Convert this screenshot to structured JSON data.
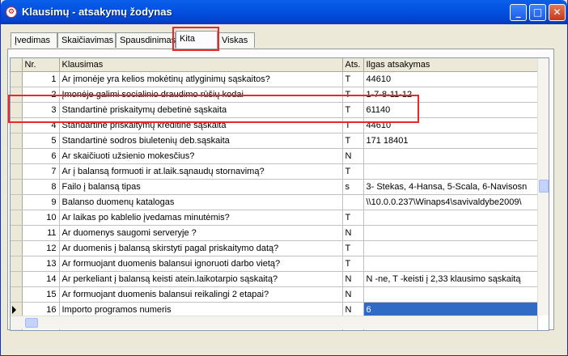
{
  "window": {
    "title": "Klausimų - atsakymų žodynas"
  },
  "tabs": [
    {
      "label": "Įvedimas"
    },
    {
      "label": "Skaičiavimas"
    },
    {
      "label": "Spausdinimas"
    },
    {
      "label": "Kita"
    },
    {
      "label": "Viskas"
    }
  ],
  "active_tab": "Kita",
  "table": {
    "headers": [
      "Nr.",
      "Klausimas",
      "Ats.",
      "Ilgas atsakymas"
    ],
    "rows": [
      {
        "nr": "1",
        "q": "Ar įmonėje yra kelios mokėtinų atlyginimų sąskaitos?",
        "a": "T",
        "long": "44610"
      },
      {
        "nr": "2",
        "q": "Įmonėje galimi socialinio draudimo rūšių kodai",
        "a": "T",
        "long": "1-7-8-11-12"
      },
      {
        "nr": "3",
        "q": "Standartinė priskaitymų debetinė sąskaita",
        "a": "T",
        "long": "61140"
      },
      {
        "nr": "4",
        "q": "Standartinė priskaitymų kreditinė sąskaita",
        "a": "T",
        "long": "44610"
      },
      {
        "nr": "5",
        "q": "Standartinė sodros biuletenių deb.sąskaita",
        "a": "T",
        "long": "171 18401"
      },
      {
        "nr": "6",
        "q": "Ar skaičiuoti užsienio mokesčius?",
        "a": "N",
        "long": ""
      },
      {
        "nr": "7",
        "q": "Ar į balansą formuoti ir at.laik.sąnaudų stornavimą?",
        "a": "T",
        "long": ""
      },
      {
        "nr": "8",
        "q": "Failo į balansą tipas",
        "a": "s",
        "long": "3- Stekas, 4-Hansa, 5-Scala, 6-Navisosn"
      },
      {
        "nr": "9",
        "q": "Balanso duomenų katalogas",
        "a": "",
        "long": "\\\\10.0.0.237\\Winaps4\\savivaldybe2009\\"
      },
      {
        "nr": "10",
        "q": "Ar laikas po kablelio įvedamas minutėmis?",
        "a": "T",
        "long": ""
      },
      {
        "nr": "11",
        "q": "Ar duomenys saugomi serveryje ?",
        "a": "N",
        "long": ""
      },
      {
        "nr": "12",
        "q": "Ar duomenis į balansą skirstyti pagal priskaitymo datą?",
        "a": "T",
        "long": ""
      },
      {
        "nr": "13",
        "q": "Ar formuojant duomenis balansui ignoruoti darbo vietą?",
        "a": "T",
        "long": ""
      },
      {
        "nr": "14",
        "q": "Ar perkeliant į balansą keisti atein.laikotarpio sąskaitą?",
        "a": "N",
        "long": "N -ne, T -keisti į 2,33 klausimo sąskaitą"
      },
      {
        "nr": "15",
        "q": "Ar formuojant duomenis balansui reikalingi 2 etapai?",
        "a": "N",
        "long": ""
      },
      {
        "nr": "16",
        "q": "Importo programos numeris",
        "a": "N",
        "long": "6"
      }
    ]
  }
}
